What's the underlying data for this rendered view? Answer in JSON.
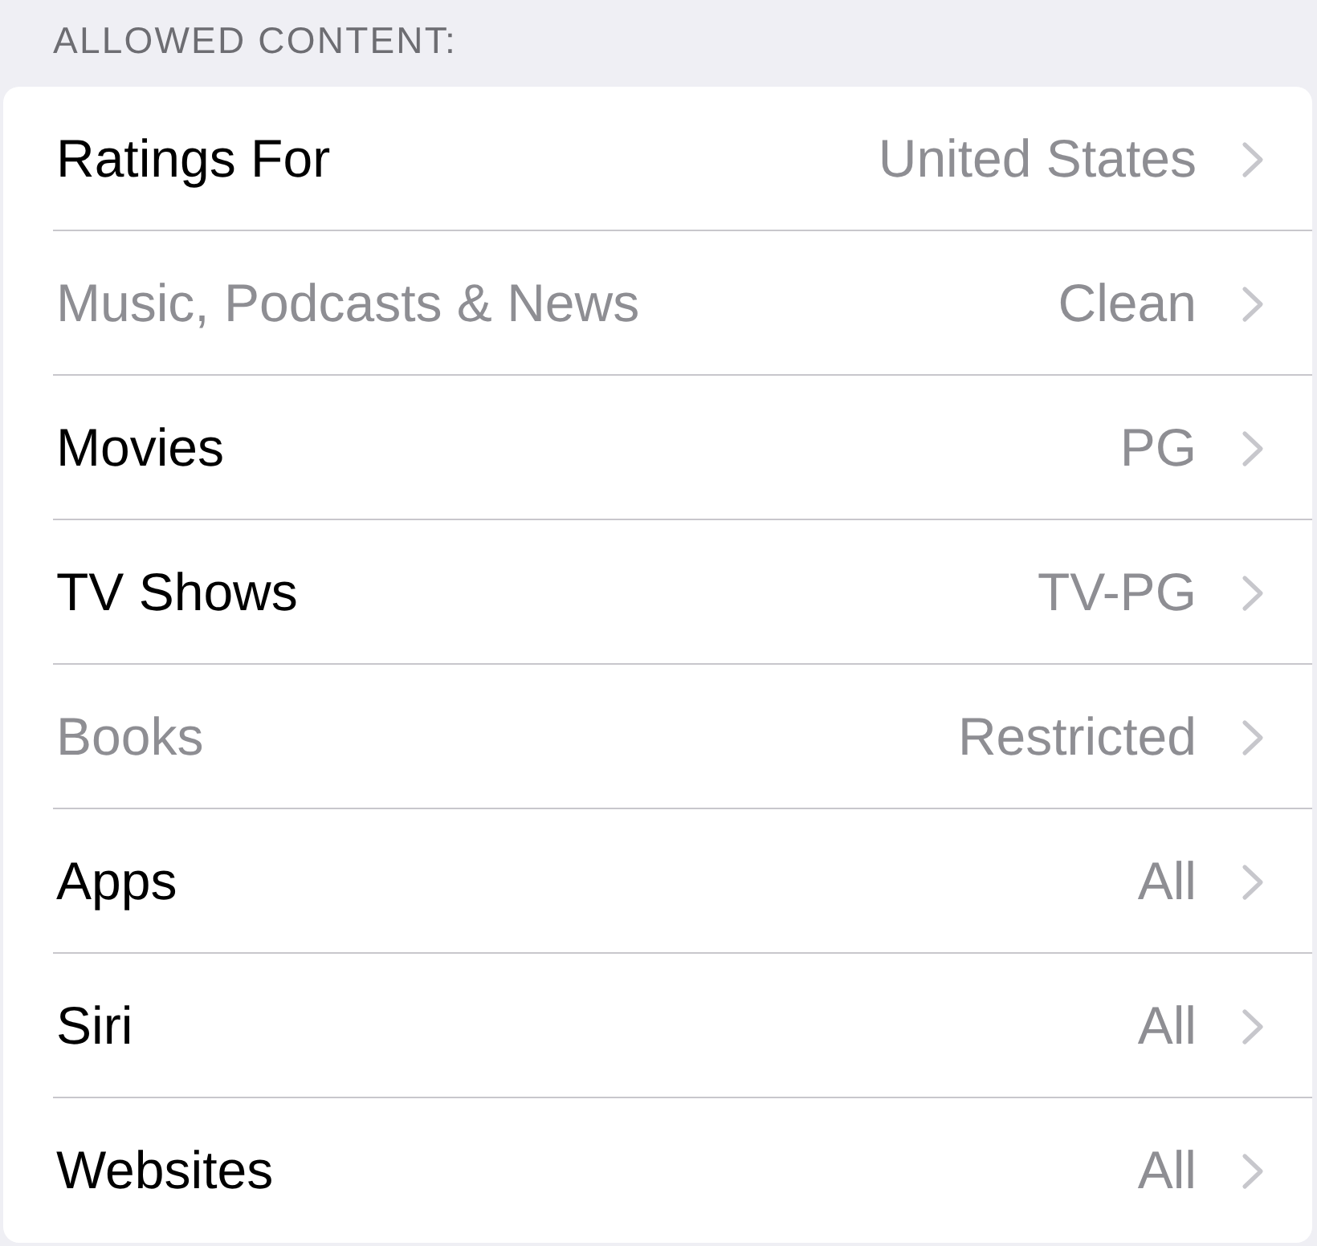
{
  "section": {
    "header": "ALLOWED CONTENT:"
  },
  "rows": [
    {
      "label": "Ratings For",
      "value": "United States",
      "disabled": false
    },
    {
      "label": "Music, Podcasts & News",
      "value": "Clean",
      "disabled": true
    },
    {
      "label": "Movies",
      "value": "PG",
      "disabled": false
    },
    {
      "label": "TV Shows",
      "value": "TV-PG",
      "disabled": false
    },
    {
      "label": "Books",
      "value": "Restricted",
      "disabled": true
    },
    {
      "label": "Apps",
      "value": "All",
      "disabled": false
    },
    {
      "label": "Siri",
      "value": "All",
      "disabled": false
    },
    {
      "label": "Websites",
      "value": "All",
      "disabled": false
    }
  ]
}
